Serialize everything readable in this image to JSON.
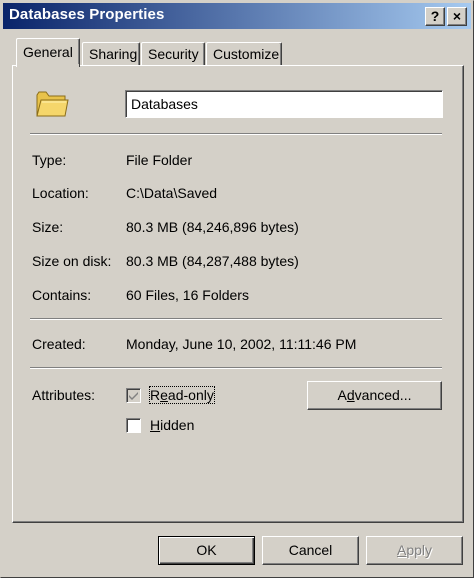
{
  "window": {
    "title": "Databases Properties",
    "help_glyph": "?",
    "close_glyph": "×"
  },
  "tabs": [
    {
      "label": "General",
      "active": true
    },
    {
      "label": "Sharing",
      "active": false
    },
    {
      "label": "Security",
      "active": false
    },
    {
      "label": "Customize",
      "active": false
    }
  ],
  "general": {
    "icon": "folder-icon",
    "name_value": "Databases",
    "type_label": "Type:",
    "type_value": "File Folder",
    "location_label": "Location:",
    "location_value": "C:\\Data\\Saved",
    "size_label": "Size:",
    "size_value": "80.3 MB (84,246,896 bytes)",
    "size_on_disk_label": "Size on disk:",
    "size_on_disk_value": "80.3 MB (84,287,488 bytes)",
    "contains_label": "Contains:",
    "contains_value": "60 Files, 16 Folders",
    "created_label": "Created:",
    "created_value": "Monday, June 10, 2002, 11:11:46 PM",
    "attributes_label": "Attributes:",
    "readonly_pre": "R",
    "readonly_mnemonic": "e",
    "readonly_post": "ad-only",
    "readonly_checked": true,
    "hidden_mnemonic": "H",
    "hidden_post": "idden",
    "hidden_checked": false,
    "advanced_pre": "A",
    "advanced_mnemonic": "d",
    "advanced_post": "vanced..."
  },
  "buttons": {
    "ok": "OK",
    "cancel": "Cancel",
    "apply_mnemonic": "A",
    "apply_post": "pply"
  },
  "colors": {
    "face": "#d4d0c8",
    "title_start": "#0a246a",
    "title_end": "#a6caf0",
    "folder": "#f5d66b"
  }
}
